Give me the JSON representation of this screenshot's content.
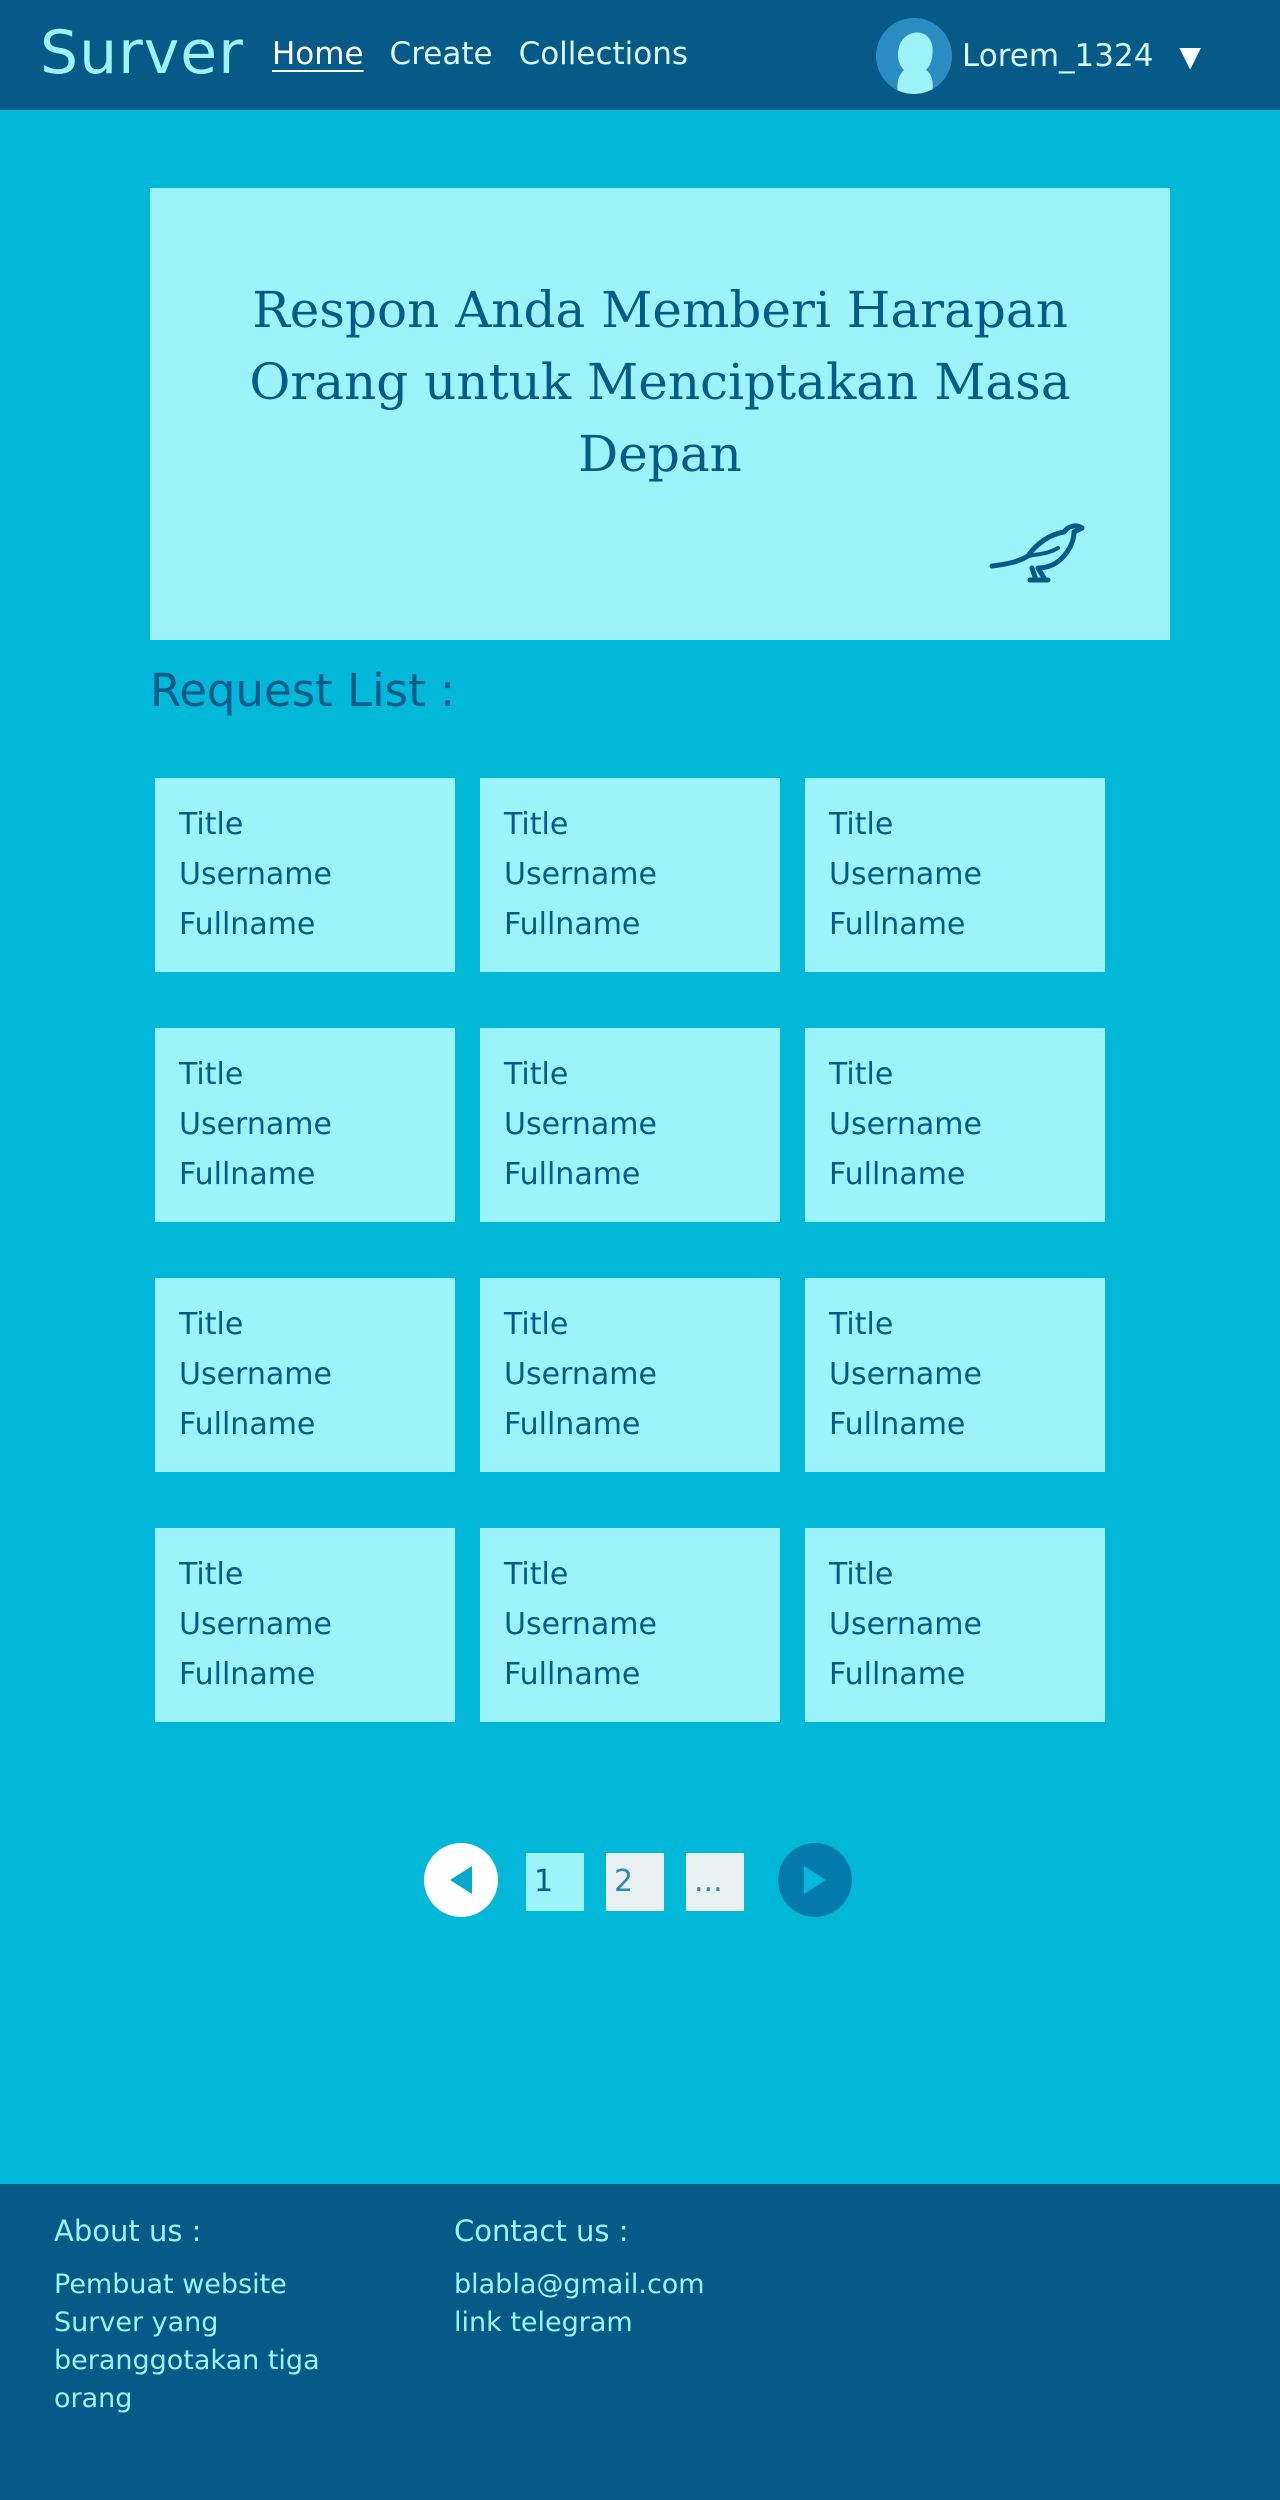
{
  "header": {
    "logo": "Surver",
    "nav": [
      "Home",
      "Create",
      "Collections"
    ],
    "user": "Lorem_1324",
    "caret": "▼"
  },
  "hero": {
    "title": "Respon Anda Memberi Harapan Orang untuk Menciptakan Masa Depan",
    "icon": "bird-icon"
  },
  "request_list": {
    "title": "Request List :",
    "cards": [
      {
        "title": "Title",
        "username": "Username",
        "fullname": "Fullname"
      },
      {
        "title": "Title",
        "username": "Username",
        "fullname": "Fullname"
      },
      {
        "title": "Title",
        "username": "Username",
        "fullname": "Fullname"
      },
      {
        "title": "Title",
        "username": "Username",
        "fullname": "Fullname"
      },
      {
        "title": "Title",
        "username": "Username",
        "fullname": "Fullname"
      },
      {
        "title": "Title",
        "username": "Username",
        "fullname": "Fullname"
      },
      {
        "title": "Title",
        "username": "Username",
        "fullname": "Fullname"
      },
      {
        "title": "Title",
        "username": "Username",
        "fullname": "Fullname"
      },
      {
        "title": "Title",
        "username": "Username",
        "fullname": "Fullname"
      },
      {
        "title": "Title",
        "username": "Username",
        "fullname": "Fullname"
      },
      {
        "title": "Title",
        "username": "Username",
        "fullname": "Fullname"
      },
      {
        "title": "Title",
        "username": "Username",
        "fullname": "Fullname"
      }
    ]
  },
  "pagination": {
    "pages": [
      "1",
      "2",
      "..."
    ],
    "current": "1"
  },
  "footer": {
    "about_title": "About us :",
    "about_text": "Pembuat website Surver yang beranggotakan tiga orang",
    "contact_title": "Contact us :",
    "email": "blabla@gmail.com",
    "telegram": "link telegram"
  },
  "colors": {
    "page_bg": "#02b8d8",
    "header_bg": "#055a88",
    "card_bg": "#9cf4fa",
    "text_dark": "#055a88"
  }
}
